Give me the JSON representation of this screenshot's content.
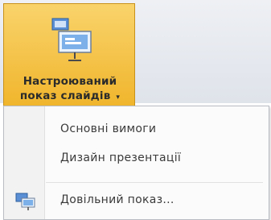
{
  "ribbon": {
    "button_line1": "Настроюваний",
    "button_line2": "показ слайдів",
    "button_chevron": "▾",
    "button_icon": "slideshow-screen-icon"
  },
  "menu": {
    "items": [
      {
        "label": "Основні вимоги"
      },
      {
        "label": "Дизайн презентації"
      },
      {
        "label": "Довільний показ...",
        "icon": "custom-show-icon"
      }
    ]
  },
  "colors": {
    "button_highlight": "#f4c04a",
    "menu_background": "#fbfbfb"
  }
}
